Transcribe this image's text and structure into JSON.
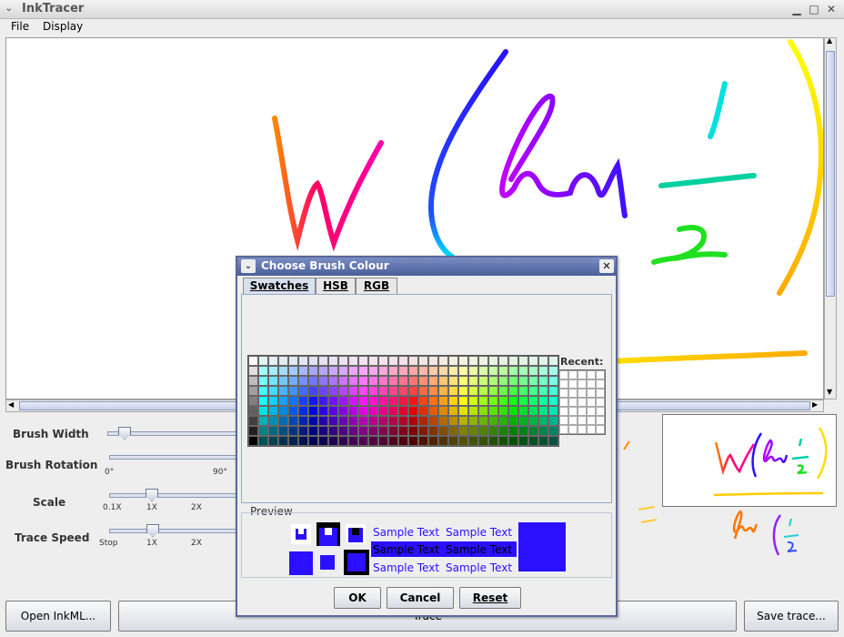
{
  "window": {
    "title": "InkTracer"
  },
  "menu": {
    "file": "File",
    "display": "Display"
  },
  "controls": {
    "brush_width": {
      "label": "Brush Width"
    },
    "brush_rotation": {
      "label": "Brush Rotation",
      "ticks": [
        "0°",
        "90°"
      ]
    },
    "scale": {
      "label": "Scale",
      "ticks": [
        "0.1X",
        "1X",
        "2X"
      ]
    },
    "trace_speed": {
      "label": "Trace Speed",
      "ticks": [
        "Stop",
        "1X",
        "2X"
      ]
    }
  },
  "buttons": {
    "open": "Open InkML...",
    "trace": "Trace",
    "save": "Save trace..."
  },
  "dialog": {
    "title": "Choose Brush Colour",
    "tabs": [
      "Swatches",
      "HSB",
      "RGB"
    ],
    "recent_label": "Recent:",
    "preview_label": "Preview",
    "sample_text": "Sample Text",
    "selected_color": "#2a10ff",
    "buttons": {
      "ok": "OK",
      "cancel": "Cancel",
      "reset": "Reset"
    }
  }
}
